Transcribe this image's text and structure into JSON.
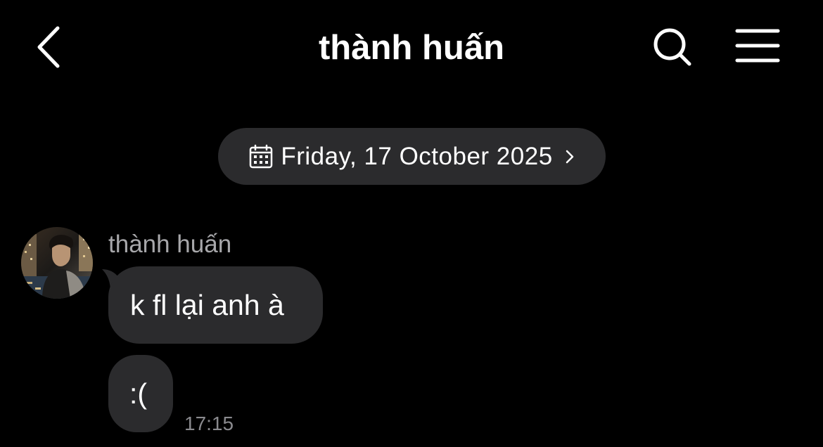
{
  "header": {
    "title": "thành huấn",
    "back_icon": "chevron-left-icon",
    "search_icon": "search-icon",
    "menu_icon": "hamburger-menu-icon"
  },
  "date_divider": {
    "icon": "calendar-icon",
    "text": "Friday, 17 October 2025",
    "chevron_icon": "chevron-right-icon"
  },
  "conversation": {
    "sender_name": "thành huấn",
    "avatar": "avatar-photo",
    "messages": [
      {
        "text": "k fl lại anh à"
      },
      {
        "text": ":(",
        "time": "17:15"
      }
    ]
  },
  "colors": {
    "background": "#000000",
    "bubble": "#2b2b2d",
    "text_primary": "#ffffff",
    "text_secondary": "#a7a7aa",
    "timestamp": "#8a8a8e"
  }
}
